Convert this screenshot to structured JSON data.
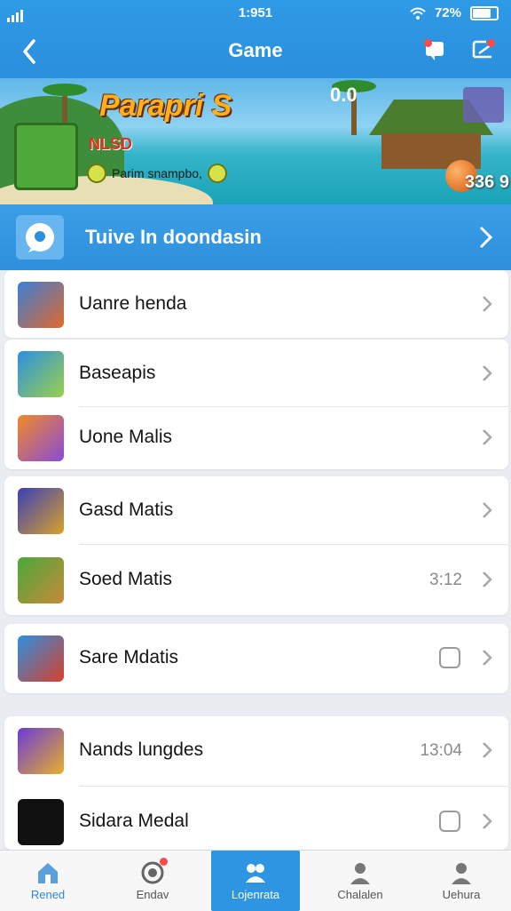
{
  "status_bar": {
    "time": "1:951",
    "battery": "72%"
  },
  "nav": {
    "title": "Game"
  },
  "banner": {
    "title": "Parapri S",
    "subtitle": "NLSD",
    "tagline": "Parim snampbo,",
    "score": "336 9",
    "corner": "0.0"
  },
  "promo": {
    "label": "Tuive In doondasin"
  },
  "groups": [
    {
      "items": [
        {
          "name": "Uanre henda",
          "meta": ""
        }
      ]
    },
    {
      "items": [
        {
          "name": "Baseapis",
          "meta": ""
        },
        {
          "name": "Uone Malis",
          "meta": ""
        }
      ]
    },
    {
      "items": [
        {
          "name": "Gasd Matis",
          "meta": ""
        },
        {
          "name": "Soed Matis",
          "meta": "3:12"
        }
      ]
    },
    {
      "items": [
        {
          "name": "Sare Mdatis",
          "meta": ""
        }
      ]
    },
    {
      "items": [
        {
          "name": "Nands lungdes",
          "meta": "13:04"
        },
        {
          "name": "Sidara Medal",
          "meta": ""
        }
      ]
    }
  ],
  "tabs": [
    {
      "label": "Rened"
    },
    {
      "label": "Endav"
    },
    {
      "label": "Lojenrata"
    },
    {
      "label": "Chalalen"
    },
    {
      "label": "Uehura"
    }
  ],
  "colors": {
    "brand": "#2e95e3",
    "badge": "#ff4a4a"
  }
}
